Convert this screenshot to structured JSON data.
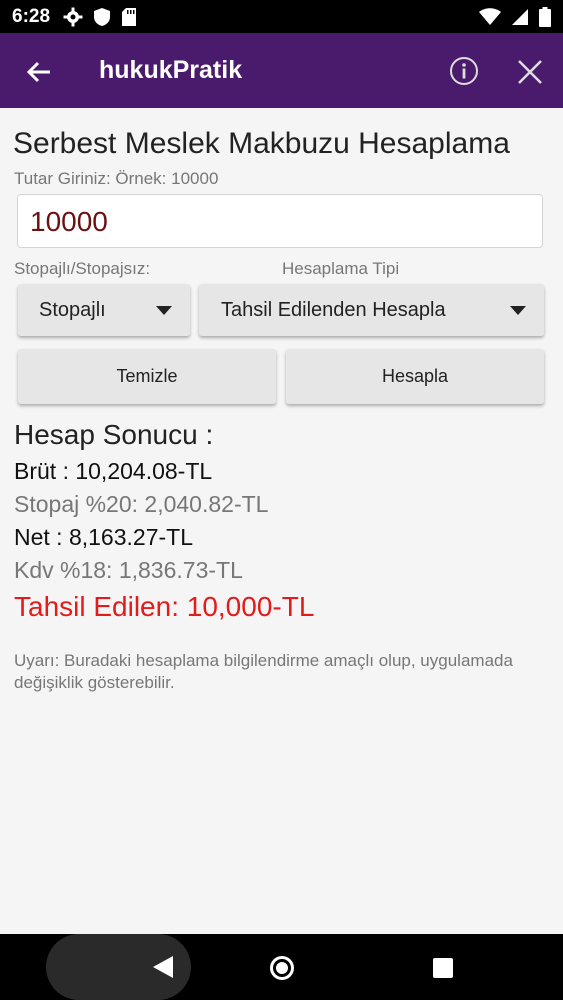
{
  "status_bar": {
    "time": "6:28",
    "left_icons": [
      "gear-icon",
      "shield-icon",
      "sd-card-icon"
    ],
    "right_icons": [
      "wifi-icon",
      "signal-icon",
      "battery-icon"
    ]
  },
  "app_bar": {
    "title": "hukukPratik",
    "background": "#4a1a6c"
  },
  "form": {
    "heading": "Serbest Meslek Makbuzu Hesaplama",
    "amount_label": "Tutar Giriniz: Örnek: 10000",
    "amount_value": "10000",
    "stopaj_label": "Stopajlı/Stopajsız:",
    "type_label": "Hesaplama Tipi",
    "stopaj_selected": "Stopajlı",
    "type_selected": "Tahsil Edilenden Hesapla",
    "clear_button": "Temizle",
    "calculate_button": "Hesapla"
  },
  "result": {
    "heading": "Hesap Sonucu :",
    "brut": "Brüt : 10,204.08-TL",
    "stopaj": "Stopaj %20: 2,040.82-TL",
    "net": "Net : 8,163.27-TL",
    "kdv": "Kdv %18: 1,836.73-TL",
    "tahsil": "Tahsil Edilen: 10,000-TL",
    "highlight_color": "#e21b1b"
  },
  "warning": "Uyarı: Buradaki hesaplama bilgilendirme amaçlı olup, uygulamada değişiklik gösterebilir.",
  "nav_bar": {
    "icons": [
      "back-icon",
      "home-icon",
      "recents-icon"
    ]
  }
}
